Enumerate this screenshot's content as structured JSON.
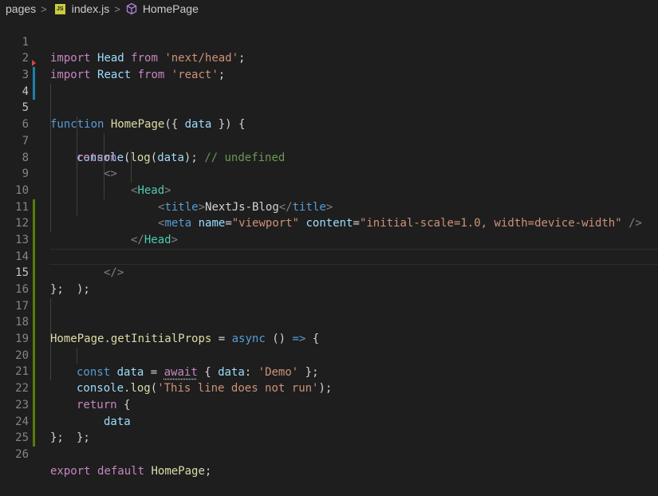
{
  "breadcrumb": {
    "folder": "pages",
    "file": "index.js",
    "file_icon_label": "JS",
    "symbol": "HomePage"
  },
  "line_numbers": [
    "1",
    "2",
    "3",
    "4",
    "5",
    "6",
    "7",
    "8",
    "9",
    "10",
    "11",
    "12",
    "13",
    "14",
    "15",
    "16",
    "17",
    "18",
    "19",
    "20",
    "21",
    "22",
    "23",
    "24",
    "25",
    "26"
  ],
  "code": {
    "l1": [
      "import",
      "Head",
      "from",
      "'next/head'",
      ";"
    ],
    "l2": [
      "import",
      "React",
      "from",
      "'react'",
      ";"
    ],
    "l4": [
      "function",
      "HomePage",
      "({ ",
      "data",
      " }) {"
    ],
    "l5": [
      "console",
      ".",
      "log",
      "(",
      "data",
      "); ",
      "// undefined"
    ],
    "l6": [
      "return",
      " ("
    ],
    "l7": [
      "<>"
    ],
    "l8": [
      "<",
      "Head",
      ">"
    ],
    "l9": [
      "<",
      "title",
      ">",
      "NextJs-Blog",
      "</",
      "title",
      ">"
    ],
    "l10": [
      "<",
      "meta",
      "name",
      "=",
      "\"viewport\"",
      "content",
      "=",
      "\"initial-scale=1.0, width=device-width\"",
      " />"
    ],
    "l11": [
      "</",
      "Head",
      ">"
    ],
    "l12": [
      "</>"
    ],
    "l13": [
      ");"
    ],
    "l14": [
      "};"
    ],
    "l17": [
      "HomePage",
      ".",
      "getInitialProps",
      " = ",
      "async",
      " () ",
      "=>",
      " {"
    ],
    "l18": [
      "const",
      "data",
      " = ",
      "await",
      " { ",
      "data",
      ": ",
      "'Demo'",
      " };"
    ],
    "l19": [
      "console",
      ".",
      "log",
      "(",
      "'This line does not run'",
      ");"
    ],
    "l20": [
      "return",
      " {"
    ],
    "l21": [
      "data"
    ],
    "l22": [
      "};"
    ],
    "l23": [
      "};"
    ],
    "l25": [
      "export",
      "default",
      "HomePage",
      ";"
    ]
  },
  "colors": {
    "background": "#1e1e1e",
    "keyword": "#569cd6",
    "control_keyword": "#c586c0",
    "function": "#dcdcaa",
    "variable": "#9cdcfe",
    "string": "#ce9178",
    "comment": "#6a9955",
    "jsx_tag": "#4ec9b0",
    "gutter_added": "#587c0c",
    "gutter_modified": "#1b81a8"
  }
}
